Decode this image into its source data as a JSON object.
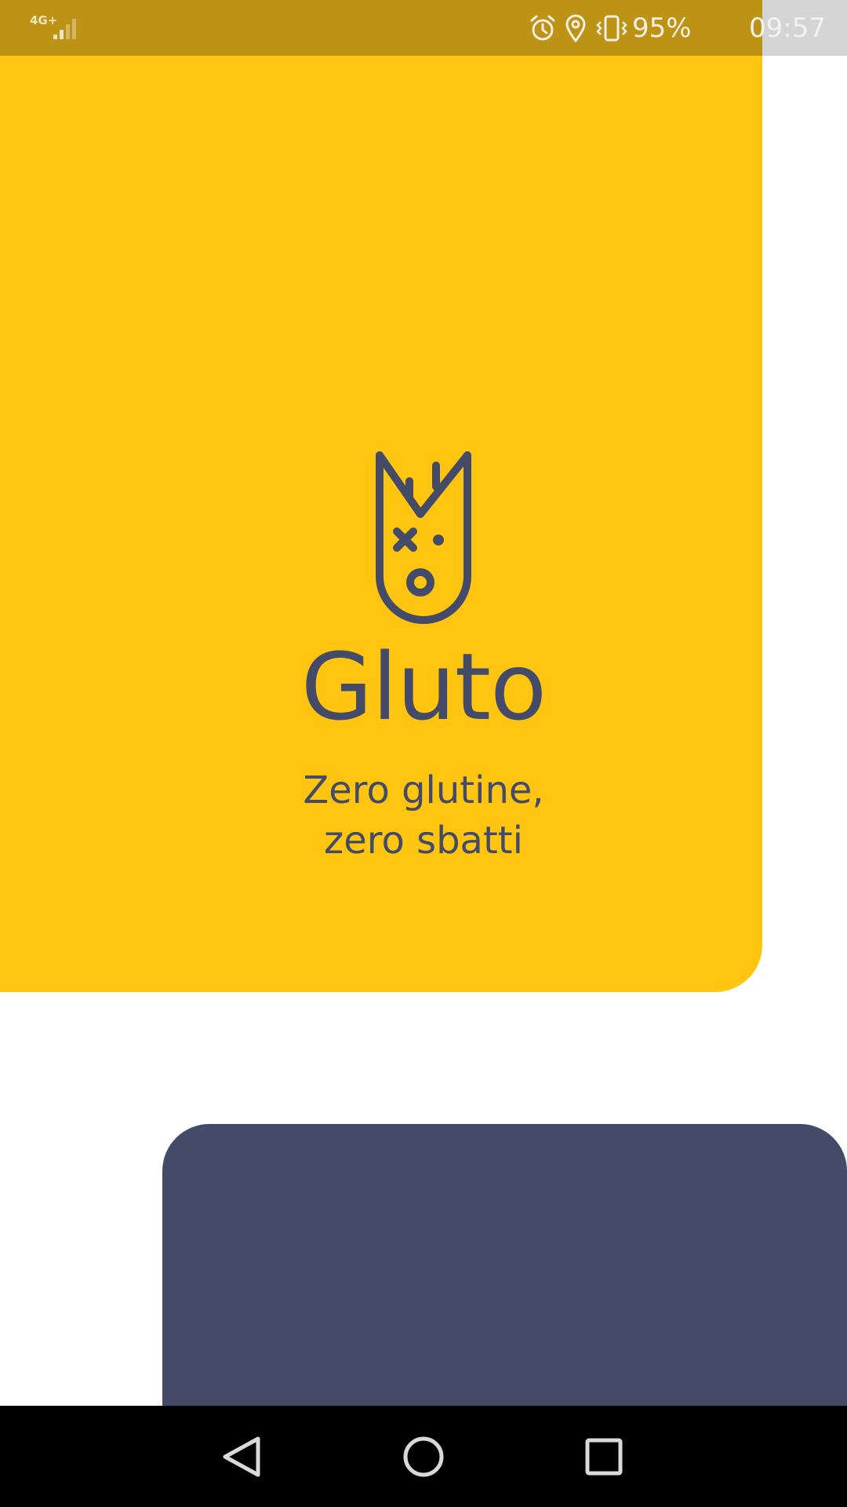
{
  "status_bar": {
    "network_label": "4G+",
    "battery_percent": "95%",
    "battery_level": 0.95,
    "time": "09:57",
    "icons": [
      "signal-icon",
      "alarm-icon",
      "location-icon",
      "vibrate-icon",
      "battery-icon"
    ]
  },
  "splash": {
    "brand_name": "Gluto",
    "tagline_line1": "Zero glutine,",
    "tagline_line2": "zero sbatti",
    "logo_icon": "gluto-logo-icon"
  },
  "navigation_bar": {
    "buttons": [
      "back-icon",
      "home-icon",
      "recents-icon"
    ]
  },
  "colors": {
    "brand_yellow": "#FFC510",
    "brand_navy": "#434B68",
    "status_bar_tint": "#BC9315",
    "background": "#FFFFFF",
    "nav_bar": "#000000"
  }
}
